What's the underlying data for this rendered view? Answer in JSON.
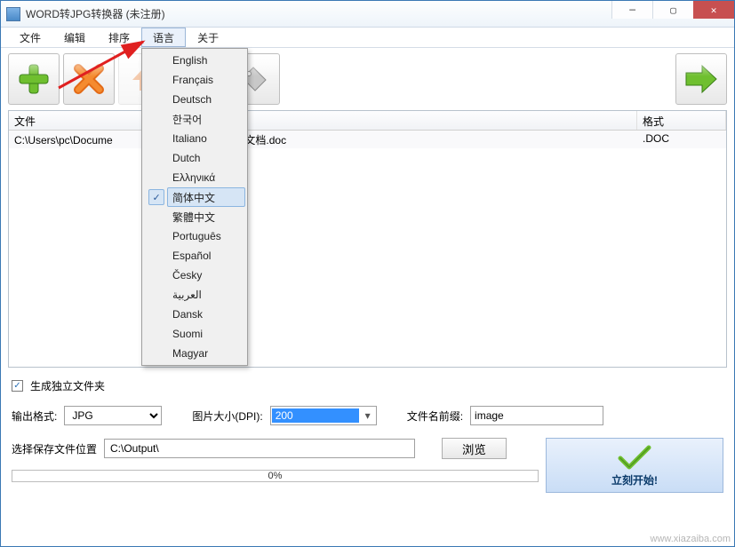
{
  "title": "WORD转JPG转换器 (未注册)",
  "menus": {
    "file": "文件",
    "edit": "编辑",
    "sort": "排序",
    "language": "语言",
    "about": "关于"
  },
  "lang_dropdown": [
    "English",
    "Français",
    "Deutsch",
    "한국어",
    "Italiano",
    "Dutch",
    "Ελληνικά",
    "简体中文",
    "繁體中文",
    "Português",
    "Español",
    "Česky",
    "العربية",
    "Dansk",
    "Suomi",
    "Magyar"
  ],
  "lang_selected_index": 7,
  "toolbar_icons": [
    "add",
    "remove",
    "up",
    "down",
    "settings"
  ],
  "right_icon": "next",
  "list": {
    "header_file": "文件",
    "header_format": "格式",
    "rows": [
      {
        "file_prefix": "C:\\Users\\pc\\Docume",
        "file_suffix": "C 文档.doc",
        "format": ".DOC"
      }
    ]
  },
  "checkbox_label": "生成独立文件夹",
  "checkbox_checked": true,
  "output_format_label": "输出格式:",
  "output_format_value": "JPG",
  "dpi_label": "图片大小(DPI):",
  "dpi_value": "200",
  "prefix_label": "文件名前缀:",
  "prefix_value": "image",
  "outdir_label": "选择保存文件位置",
  "outdir_value": "C:\\Output\\",
  "browse_label": "浏览",
  "progress_text": "0%",
  "start_label": "立刻开始!",
  "watermark": "www.xiazaiba.com"
}
